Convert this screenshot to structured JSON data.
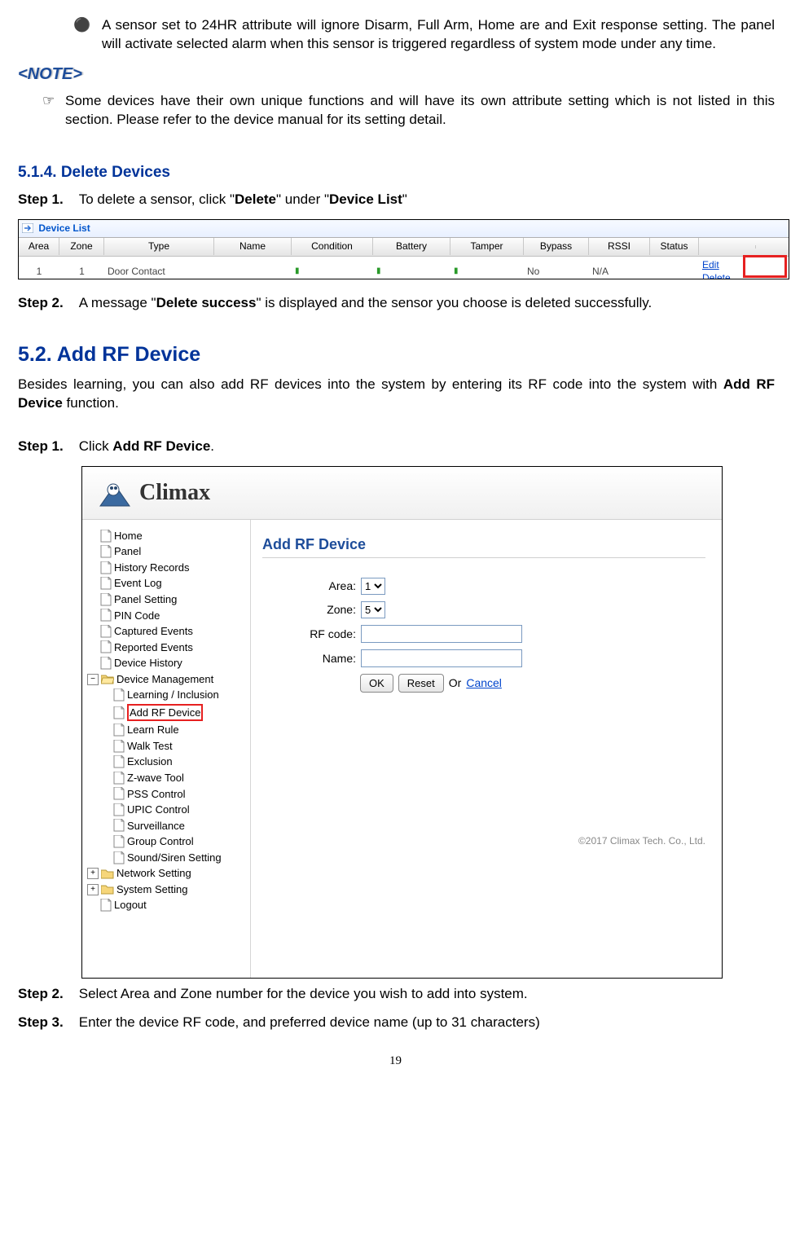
{
  "bullet_24hr": "A sensor set to 24HR attribute will ignore Disarm, Full Arm, Home are and Exit response setting. The panel will activate selected alarm when this sensor is triggered regardless of system mode under any time.",
  "note_label": "<NOTE>",
  "note_body": "Some devices have their own unique functions and will have its own attribute setting which is not listed in this section. Please refer to the device manual for its setting detail.",
  "sec514_title": "5.1.4. Delete Devices",
  "step1_label": "Step 1.",
  "step1_body_pre": "To delete a sensor, click \"",
  "step1_body_b1": "Delete",
  "step1_body_mid": "\" under \"",
  "step1_body_b2": "Device List",
  "step1_body_post": "\"",
  "device_list": {
    "title": "Device List",
    "headers": [
      "Area",
      "Zone",
      "Type",
      "Name",
      "Condition",
      "Battery",
      "Tamper",
      "Bypass",
      "RSSI",
      "Status",
      ""
    ],
    "row": {
      "area": "1",
      "zone": "1",
      "type": "Door Contact",
      "name": "",
      "condition": "",
      "battery": "",
      "tamper": "",
      "bypass": "No",
      "rssi": "N/A",
      "status": ""
    },
    "edit": "Edit",
    "delete": "Delete"
  },
  "step2_label": "Step 2.",
  "step2_body_pre": "A message \"",
  "step2_body_b1": "Delete success",
  "step2_body_post": "\" is displayed and the sensor you choose is deleted successfully.",
  "sec52_title": "5.2. Add RF Device",
  "sec52_intro_pre": "Besides learning, you can also add RF devices into the system by entering its RF code into the system with ",
  "sec52_intro_b": "Add RF Device",
  "sec52_intro_post": " function.",
  "s52_step1_label": "Step 1.",
  "s52_step1_pre": "Click ",
  "s52_step1_b": "Add RF Device",
  "s52_step1_post": ".",
  "app": {
    "logo_text": "Climax",
    "sidebar": {
      "items_top": [
        "Home",
        "Panel",
        "History Records",
        "Event Log",
        "Panel Setting",
        "PIN Code",
        "Captured Events",
        "Reported Events",
        "Device History"
      ],
      "dm_label": "Device Management",
      "dm_children": [
        "Learning / Inclusion",
        "Add RF Device",
        "Learn Rule",
        "Walk Test",
        "Exclusion",
        "Z-wave Tool",
        "PSS Control",
        "UPIC Control",
        "Surveillance",
        "Group Control",
        "Sound/Siren Setting"
      ],
      "ns_label": "Network Setting",
      "ss_label": "System Setting",
      "logout": "Logout"
    },
    "main": {
      "title": "Add RF Device",
      "area_label": "Area:",
      "area_value": "1",
      "zone_label": "Zone:",
      "zone_value": "5",
      "rf_label": "RF code:",
      "name_label": "Name:",
      "ok": "OK",
      "reset": "Reset",
      "or": "Or",
      "cancel": "Cancel",
      "copyright": "©2017 Climax Tech. Co., Ltd."
    }
  },
  "s52_step2_label": "Step 2.",
  "s52_step2_body": "Select Area and Zone number for the device you wish to add into system.",
  "s52_step3_label": "Step 3.",
  "s52_step3_body": "Enter the device RF code, and preferred device name (up to 31 characters)",
  "page_num": "19"
}
